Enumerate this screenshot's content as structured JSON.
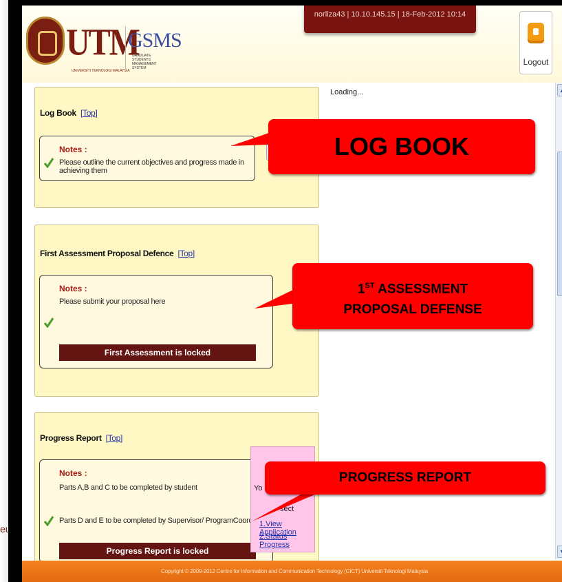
{
  "header": {
    "logo_text": "UTM",
    "logo_subtext": "UNIVERSITI TEKNOLOGI MALAYSIA",
    "gsms_text": "GSMS",
    "gsms_subtext": "GRADUATE STUDENTS MANAGEMENT SYSTEM",
    "user_info": "norliza43 | 10.10.145.15 | 18-Feb-2012 10:14",
    "logout_label": "Logout"
  },
  "status": {
    "loading": "Loading..."
  },
  "sections": [
    {
      "title": "Log Book",
      "top_link": "[Top]",
      "notes_label": "Notes :",
      "lines": [
        "Please outline the current objectives and progress made in achieving them"
      ]
    },
    {
      "title": "First Assessment Proposal Defence",
      "top_link": "[Top]",
      "notes_label": "Notes :",
      "lines": [
        "Please submit your proposal here"
      ],
      "locked_label": "First Assessment is locked"
    },
    {
      "title": "Progress Report",
      "top_link": "[Top]",
      "notes_label": "Notes :",
      "lines": [
        "Parts A,B and C to be completed by student",
        "Parts D and E to be completed by Supervisor/ ProgramCoordinator"
      ],
      "locked_label": "Progress Report is locked"
    }
  ],
  "side_box": {
    "fragment_1": "Yo",
    "fragment_2": "sect",
    "link_1": "1.View Application",
    "link_2": "2.Status Progress"
  },
  "callouts": {
    "log_book": "LOG BOOK",
    "assessment_line1_pre": "1",
    "assessment_line1_sup": "ST",
    "assessment_line1_post": " ASSESSMENT",
    "assessment_line2": "PROPOSAL DEFENSE",
    "progress_report": "PROGRESS REPORT"
  },
  "left_fragment": "eu",
  "footer": {
    "copyright": "Copyright © 2009-2012 Centre for Information and Communication Technology (CICT) Universiti Teknologi Malaysia"
  },
  "colors": {
    "callout": "#ff0000",
    "header_bar": "#7a1410",
    "locked_bar": "#641512",
    "panel_bg": "#fff8c5",
    "footer": "#f58220"
  }
}
